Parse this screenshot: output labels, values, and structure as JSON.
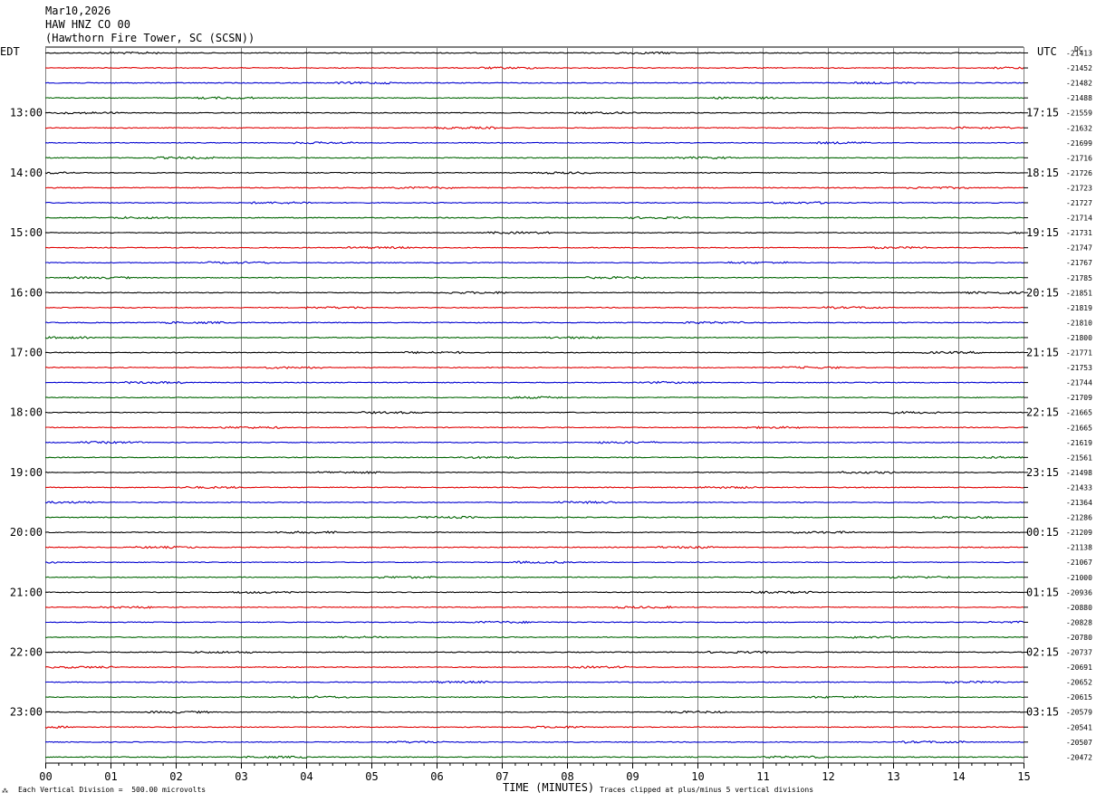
{
  "header": {
    "date": "Mar10,2026",
    "station": "HAW HNZ CO 00",
    "location": "(Hawthorn Fire Tower, SC (SCSN))"
  },
  "left_tz": "EDT",
  "right_tz": "UTC",
  "dc_label": "DC",
  "footer": {
    "scale": "Each Vertical Division =  500.00 microvolts",
    "xlabel": "TIME (MINUTES)",
    "clip": "Traces clipped at plus/minus 5 vertical divisions"
  },
  "colors": {
    "trace_cycle": [
      "#000000",
      "#e00000",
      "#0000d0",
      "#006400"
    ],
    "grid": "#808080"
  },
  "chart_data": {
    "type": "line",
    "title": "HAW HNZ CO 00",
    "xlabel": "TIME (MINUTES)",
    "x_ticks": [
      "00",
      "01",
      "02",
      "03",
      "04",
      "05",
      "06",
      "07",
      "08",
      "09",
      "10",
      "11",
      "12",
      "13",
      "14",
      "15"
    ],
    "xlim": [
      0,
      15
    ],
    "rows_per_hour": 4,
    "left_hour_labels": [
      "13:00",
      "14:00",
      "15:00",
      "16:00",
      "17:00",
      "18:00",
      "19:00",
      "20:00",
      "21:00",
      "22:00",
      "23:00"
    ],
    "right_hour_labels": [
      "17:15",
      "18:15",
      "19:15",
      "20:15",
      "21:15",
      "22:15",
      "23:15",
      "00:15",
      "01:15",
      "02:15",
      "03:15"
    ],
    "hour_label_first_row": 4,
    "dc_offsets": [
      "-21413",
      "-21452",
      "-21482",
      "-21488",
      "-21559",
      "-21632",
      "-21699",
      "-21716",
      "-21726",
      "-21723",
      "-21727",
      "-21714",
      "-21731",
      "-21747",
      "-21767",
      "-21785",
      "-21851",
      "-21819",
      "-21810",
      "-21800",
      "-21771",
      "-21753",
      "-21744",
      "-21709",
      "-21665",
      "-21665",
      "-21619",
      "-21561",
      "-21498",
      "-21433",
      "-21364",
      "-21286",
      "-21209",
      "-21138",
      "-21067",
      "-21000",
      "-20936",
      "-20880",
      "-20828",
      "-20780",
      "-20737",
      "-20691",
      "-20652",
      "-20615",
      "-20579",
      "-20541",
      "-20507",
      "-20472"
    ]
  }
}
